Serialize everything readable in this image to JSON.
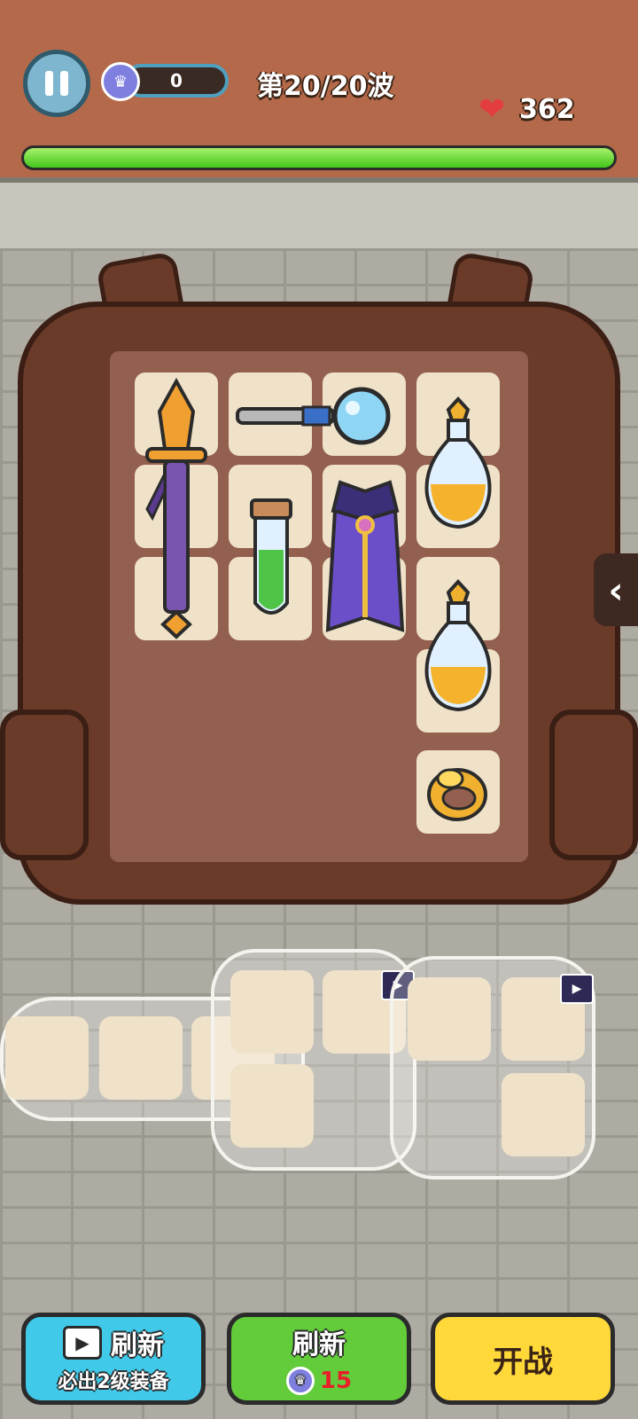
{
  "hud": {
    "gem_count": "0",
    "wave_text": "第20/20波",
    "hp_value": "362",
    "hp_fill_percent": 100,
    "pause_icon": "pause-icon",
    "gem_icon": "crown-gem-icon",
    "heart_icon": "heart-icon"
  },
  "backpack": {
    "items": [
      {
        "name": "sword",
        "icon": "sword-icon"
      },
      {
        "name": "magnifier",
        "icon": "magnifying-glass-icon"
      },
      {
        "name": "yellow-potion-1",
        "icon": "yellow-potion-icon"
      },
      {
        "name": "green-potion",
        "icon": "green-potion-icon"
      },
      {
        "name": "cloak",
        "icon": "cloak-icon"
      },
      {
        "name": "yellow-potion-2",
        "icon": "yellow-potion-icon"
      },
      {
        "name": "ring",
        "icon": "gold-ring-icon"
      }
    ]
  },
  "buttons": {
    "ad_refresh_label": "刷新",
    "ad_refresh_sub": "必出2级装备",
    "gem_refresh_label": "刷新",
    "gem_refresh_cost": "15",
    "start_label": "开战"
  },
  "colors": {
    "hp_green": "#43c61b",
    "btn_blue": "#40c9e8",
    "btn_green": "#63cc3a",
    "btn_yellow": "#ffd93a",
    "cost_red": "#e8202a"
  }
}
